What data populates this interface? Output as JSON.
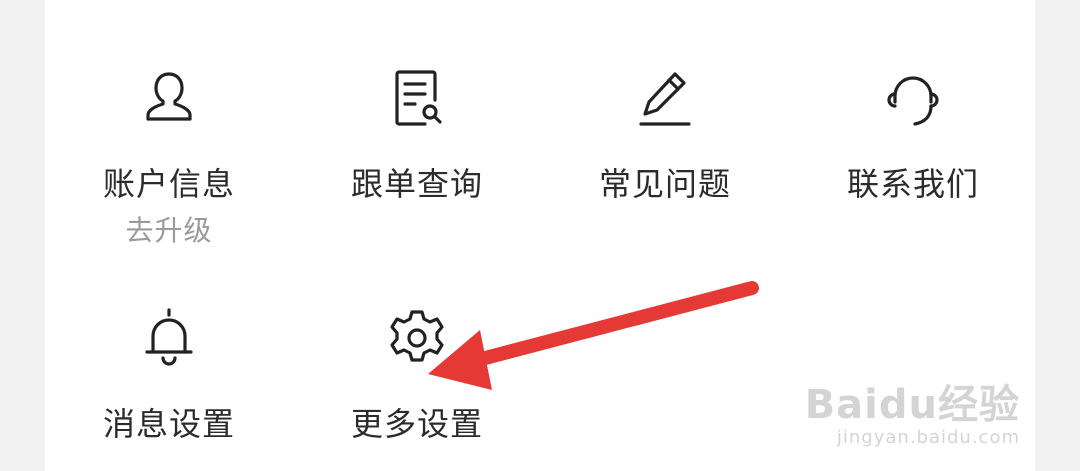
{
  "menu": {
    "items": [
      {
        "label": "账户信息",
        "sub": "去升级",
        "icon": "user-icon"
      },
      {
        "label": "跟单查询",
        "icon": "document-search-icon"
      },
      {
        "label": "常见问题",
        "icon": "pencil-icon"
      },
      {
        "label": "联系我们",
        "icon": "headset-icon"
      },
      {
        "label": "消息设置",
        "icon": "bell-icon"
      },
      {
        "label": "更多设置",
        "icon": "gear-icon"
      }
    ]
  },
  "watermark": {
    "brand": "Baidu经验",
    "url": "jingyan.baidu.com"
  },
  "annotation": {
    "arrow_color": "#e53935"
  }
}
